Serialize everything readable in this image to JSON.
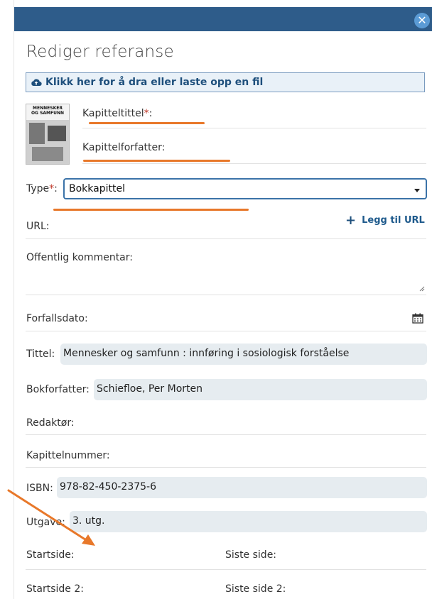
{
  "dialog": {
    "close_glyph": "✕",
    "title": "Rediger referanse",
    "upload_label": "Klikk her for å dra eller laste opp en fil"
  },
  "book_cover": {
    "line1": "MENNESKER",
    "line2": "OG SAMFUNN"
  },
  "form": {
    "chapter_title_label": "Kapitteltittel",
    "chapter_author_label": "Kapittelforfatter:",
    "type_label": "Type",
    "type_value": "Bokkapittel",
    "url_label": "URL:",
    "add_url_label": "Legg til URL",
    "comment_label": "Offentlig kommentar:",
    "due_date_label": "Forfallsdato:",
    "title_label": "Tittel:",
    "title_value": "Mennesker og samfunn : innføring i sosiologisk forståelse",
    "book_author_label": "Bokforfatter:",
    "book_author_value": "Schiefloe, Per Morten",
    "editor_label": "Redaktør:",
    "chapter_number_label": "Kapittelnummer:",
    "isbn_label": "ISBN:",
    "isbn_value": "978-82-450-2375-6",
    "edition_label": "Utgave:",
    "edition_value": "3. utg.",
    "start_page_label": "Startside:",
    "last_page_label": "Siste side:",
    "start_page2_label": "Startside 2:",
    "last_page2_label": "Siste side 2:"
  },
  "icons": [
    "cloud-upload-icon",
    "plus-icon",
    "calendar-icon",
    "resize-handle-icon",
    "chevron-down-icon",
    "close-icon"
  ],
  "colors": {
    "header": "#2e5c8a",
    "accent": "#1e4f7c",
    "annotation": "#e8782a",
    "required": "#c0392b",
    "field_bg": "#e6ecf0"
  }
}
